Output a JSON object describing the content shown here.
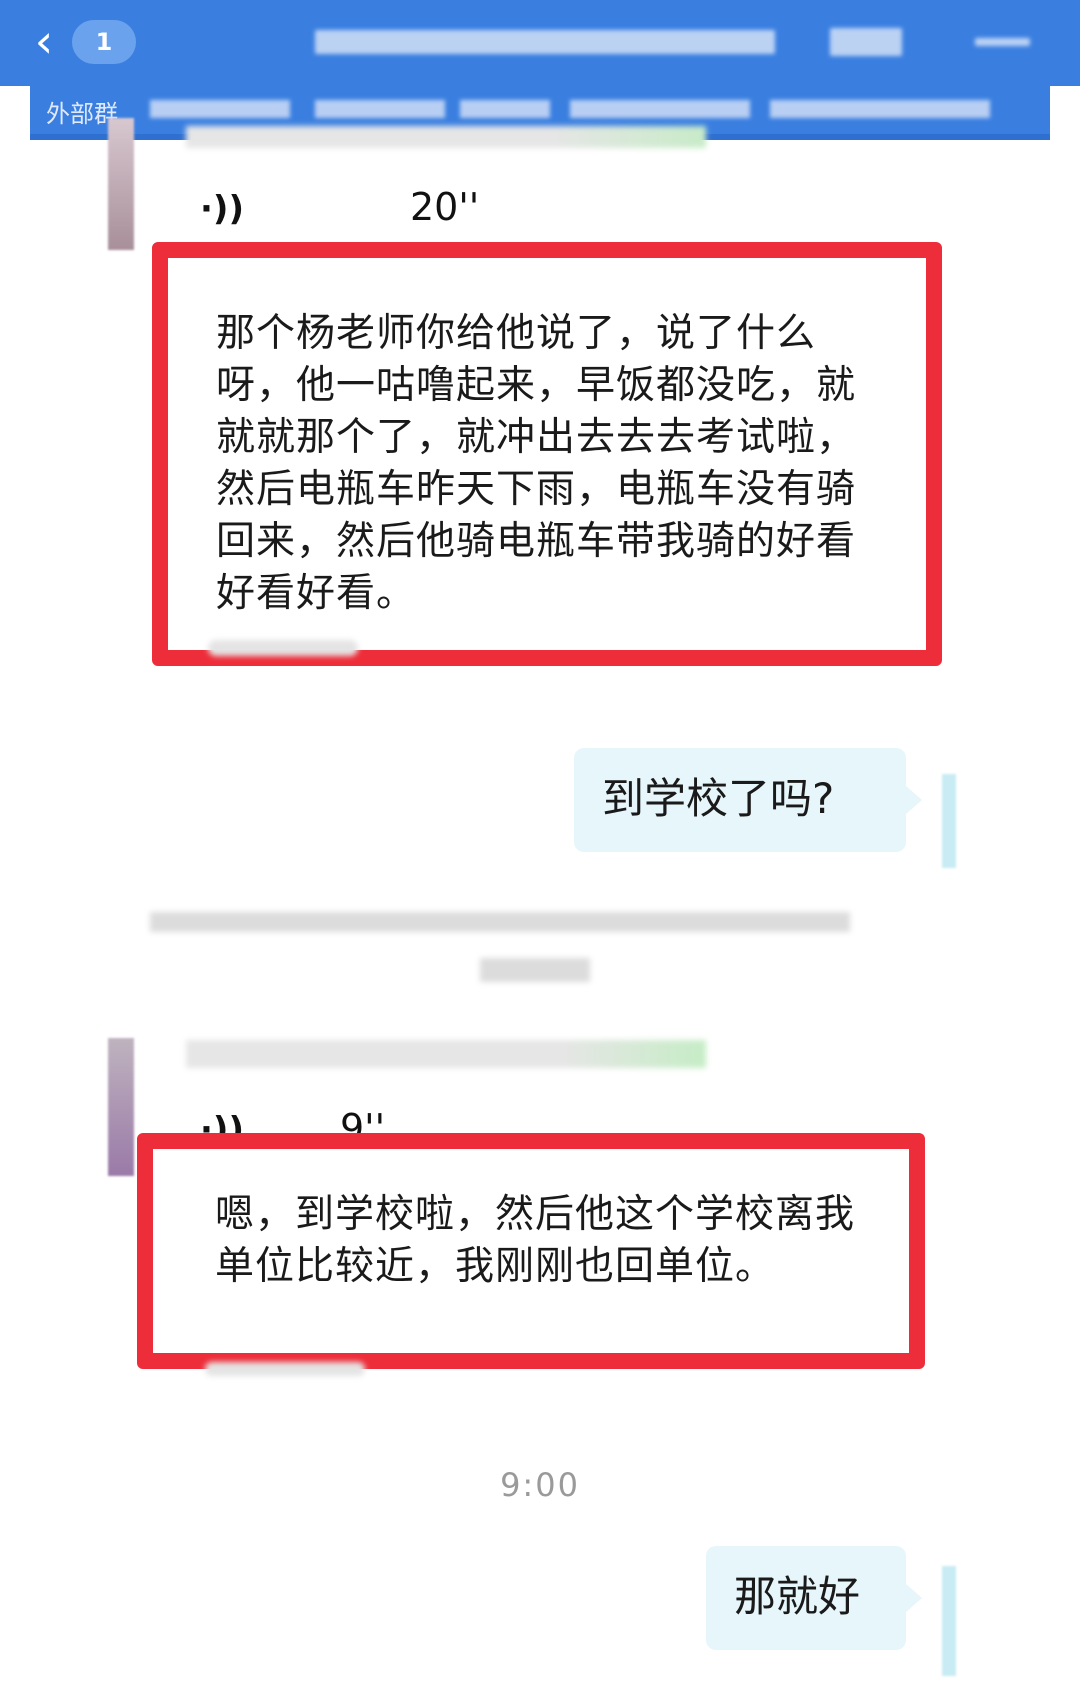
{
  "header": {
    "back_icon": "chevron-left-icon",
    "unread_count": "1",
    "subtitle_prefix": "外部群"
  },
  "messages": [
    {
      "type": "voice_in",
      "duration": "20''",
      "voice_icon": "voice-wave-icon",
      "transcript": "那个杨老师你给他说了，说了什么呀，他一咕噜起来，早饭都没吃，就就就那个了，就冲出去去去考试啦，然后电瓶车昨天下雨，电瓶车没有骑回来，然后他骑电瓶车带我骑的好看好看好看。"
    },
    {
      "type": "text_out",
      "text": "到学校了吗?"
    },
    {
      "type": "voice_in",
      "duration": "9''",
      "voice_icon": "voice-wave-icon",
      "transcript": "嗯，到学校啦，然后他这个学校离我单位比较近，我刚刚也回单位。"
    },
    {
      "type": "timestamp",
      "text": "9:00"
    },
    {
      "type": "text_out",
      "text": "那就好"
    }
  ],
  "colors": {
    "header_blue": "#3a7fe0",
    "highlight_red": "#ee2d3a",
    "outgoing_bubble": "#e6f6fb"
  }
}
